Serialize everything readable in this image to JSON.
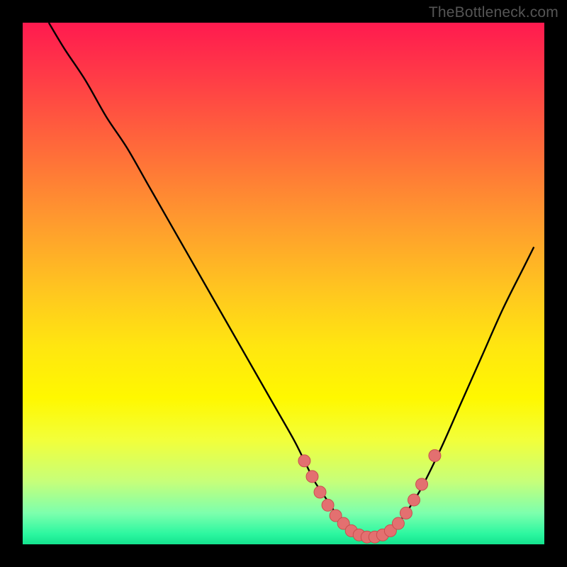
{
  "watermark": "TheBottleneck.com",
  "colors": {
    "curve": "#000000",
    "marker_fill": "#e37070",
    "marker_stroke": "#c94f4f",
    "background": "#000000"
  },
  "chart_data": {
    "type": "line",
    "title": "",
    "xlabel": "",
    "ylabel": "",
    "xlim": [
      0,
      100
    ],
    "ylim": [
      0,
      100
    ],
    "series": [
      {
        "name": "curve",
        "x": [
          5,
          8,
          12,
          16,
          20,
          24,
          28,
          32,
          36,
          40,
          44,
          48,
          52,
          54,
          56,
          58,
          60,
          62,
          64,
          66,
          68,
          70,
          72,
          76,
          80,
          84,
          88,
          92,
          96,
          98
        ],
        "y": [
          100,
          95,
          89,
          82,
          76,
          69,
          62,
          55,
          48,
          41,
          34,
          27,
          20,
          16,
          12,
          9,
          6,
          3.5,
          2,
          1.2,
          1.2,
          2,
          4,
          10,
          18,
          27,
          36,
          45,
          53,
          57
        ]
      }
    ],
    "markers": {
      "name": "optimal-range",
      "points": [
        {
          "x": 54,
          "y": 16
        },
        {
          "x": 55.5,
          "y": 13
        },
        {
          "x": 57,
          "y": 10
        },
        {
          "x": 58.5,
          "y": 7.5
        },
        {
          "x": 60,
          "y": 5.5
        },
        {
          "x": 61.5,
          "y": 4
        },
        {
          "x": 63,
          "y": 2.6
        },
        {
          "x": 64.5,
          "y": 1.8
        },
        {
          "x": 66,
          "y": 1.4
        },
        {
          "x": 67.5,
          "y": 1.4
        },
        {
          "x": 69,
          "y": 1.8
        },
        {
          "x": 70.5,
          "y": 2.6
        },
        {
          "x": 72,
          "y": 4
        },
        {
          "x": 73.5,
          "y": 6
        },
        {
          "x": 75,
          "y": 8.5
        },
        {
          "x": 76.5,
          "y": 11.5
        },
        {
          "x": 79,
          "y": 17
        }
      ]
    }
  }
}
